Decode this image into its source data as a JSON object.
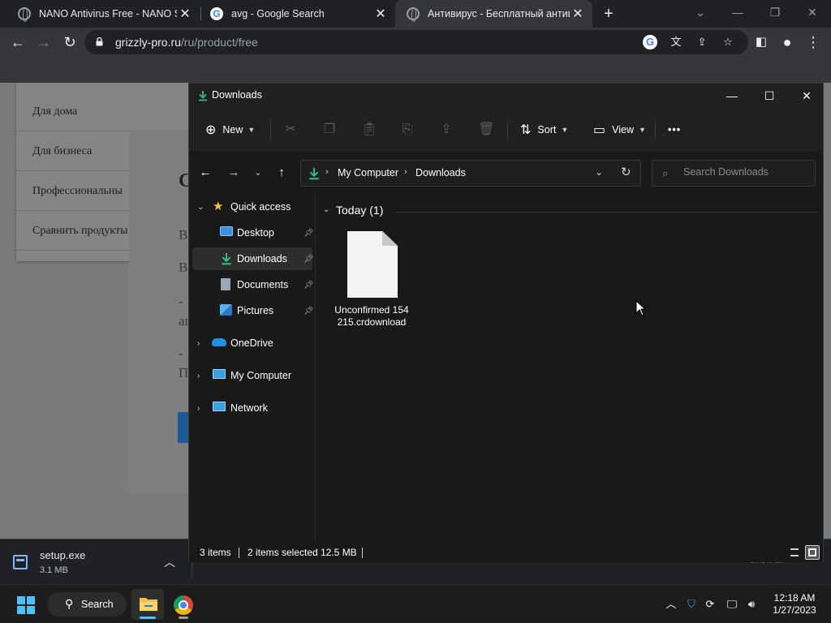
{
  "browser": {
    "tabs": [
      {
        "title": "NANO Antivirus Free - NANO Se",
        "favicon": "globe-icon",
        "active": false
      },
      {
        "title": "avg - Google Search",
        "favicon": "google-icon",
        "active": false
      },
      {
        "title": "Антивирус - Бесплатный антив",
        "favicon": "globe-icon",
        "active": true
      }
    ],
    "new_tab_label": "+",
    "address": {
      "host": "grizzly-pro.ru",
      "path": "/ru/product/free"
    }
  },
  "page": {
    "menu_items": [
      "Для дома",
      "Для бизнеса",
      "Профессиональны",
      "Сравнить продукты"
    ],
    "fragments": [
      "C",
      "B",
      "B",
      "-",
      "ar",
      "-",
      "П"
    ]
  },
  "download_bar": {
    "file_name": "setup.exe",
    "file_size": "3.1 MB",
    "show_all": "Show all"
  },
  "explorer": {
    "title": "Downloads",
    "commands": {
      "new": "New",
      "sort": "Sort",
      "view": "View",
      "more": "•••"
    },
    "breadcrumb": [
      "My Computer",
      "Downloads"
    ],
    "search_placeholder": "Search Downloads",
    "nav": {
      "quick_access": "Quick access",
      "desktop": "Desktop",
      "downloads": "Downloads",
      "documents": "Documents",
      "pictures": "Pictures",
      "onedrive": "OneDrive",
      "my_computer": "My Computer",
      "network": "Network"
    },
    "group_header": "Today (1)",
    "file": {
      "name": "Unconfirmed 154215.crdownload"
    },
    "status": {
      "items": "3 items",
      "selected": "2 items selected",
      "size": "12.5 MB"
    }
  },
  "taskbar": {
    "search_label": "Search",
    "time": "12:18 AM",
    "date": "1/27/2023"
  },
  "colors": {
    "accent": "#4cc2ff",
    "download_green": "#2ebd85",
    "folder_yellow": "#f5c242"
  }
}
